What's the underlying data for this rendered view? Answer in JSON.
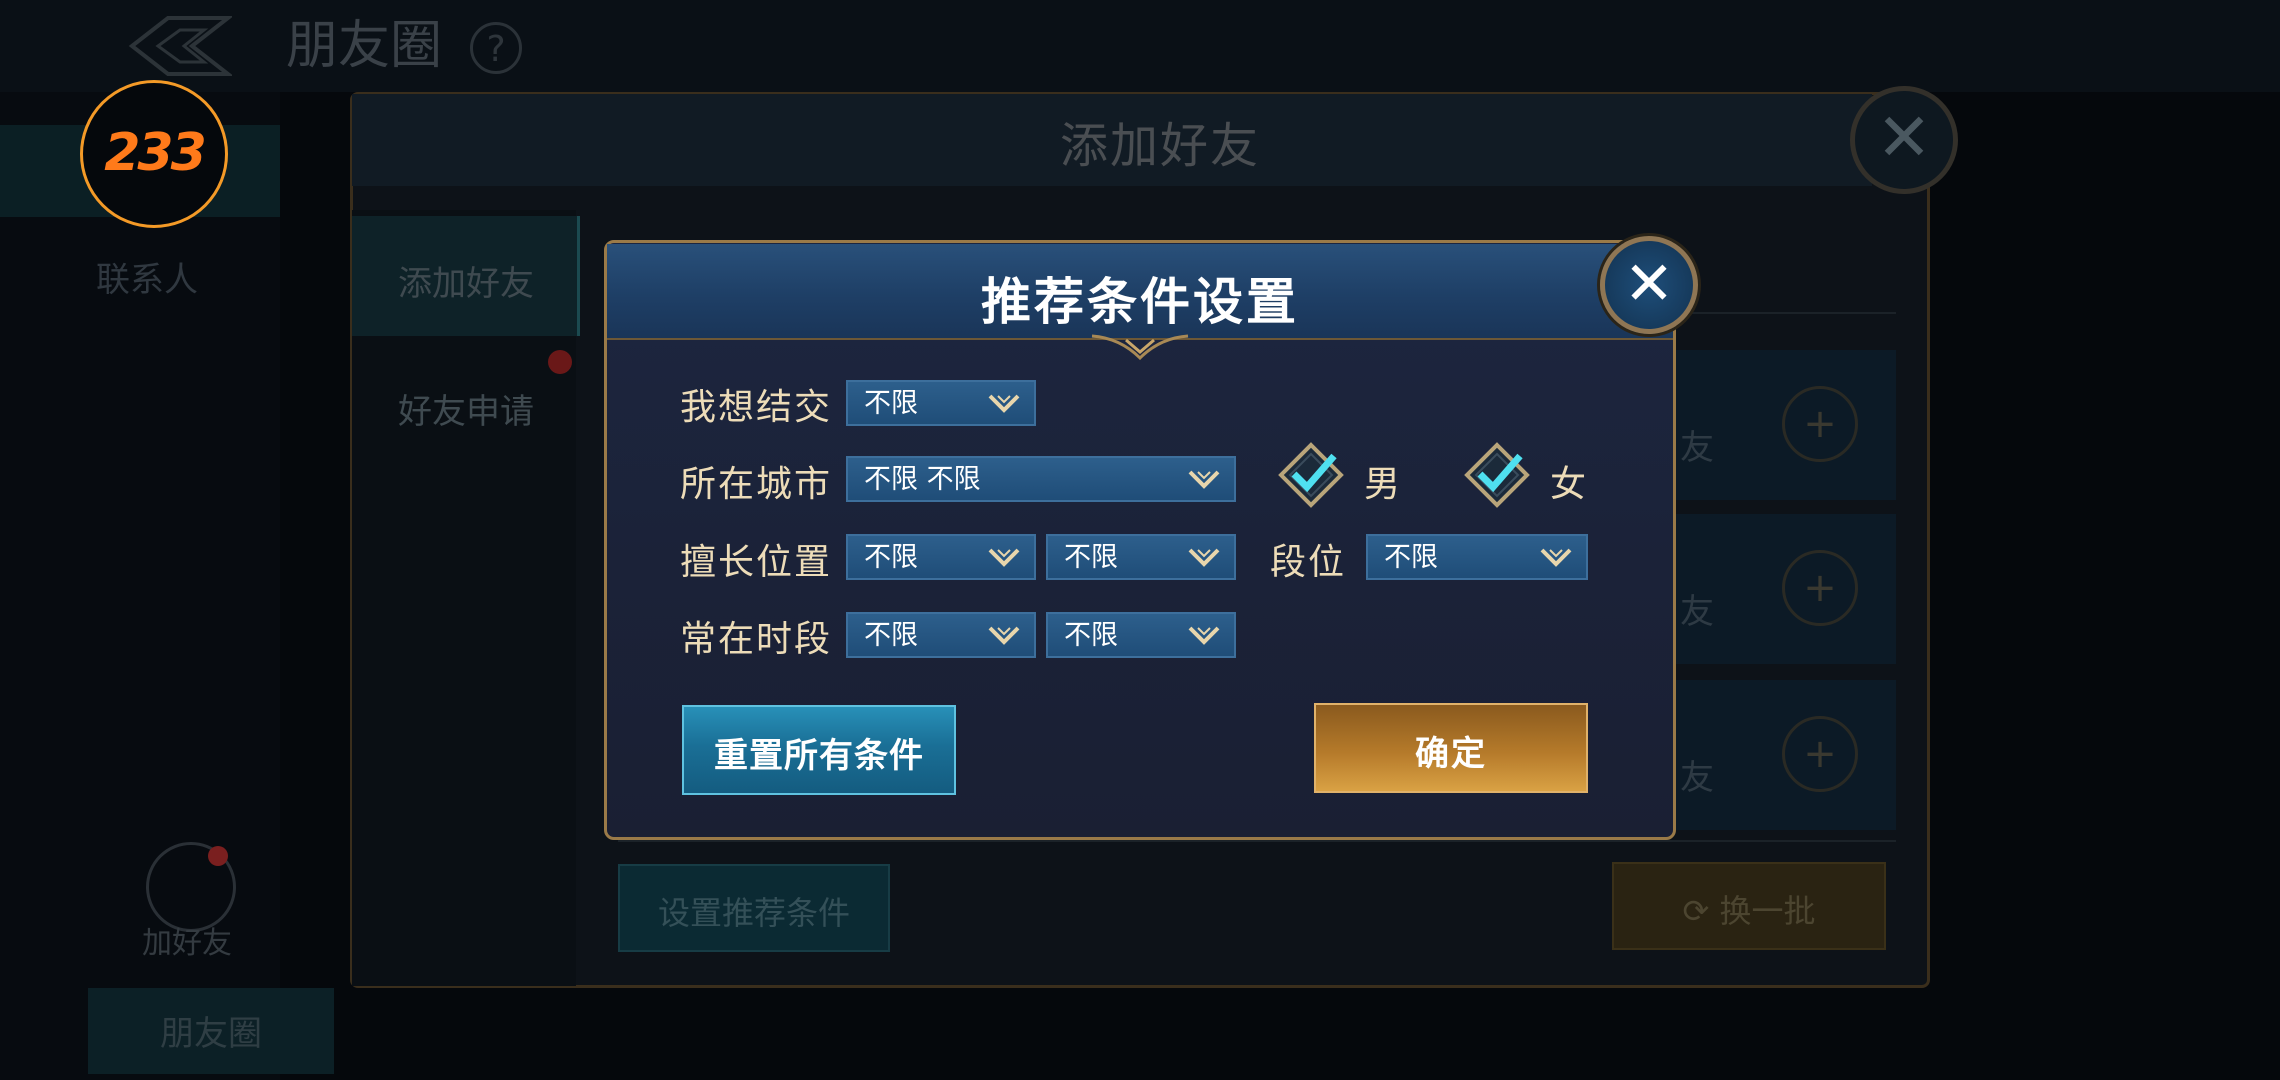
{
  "background": {
    "page_title": "朋友圈",
    "help_glyph": "?",
    "contacts_label": "联系人",
    "add_friend_label": "加好友",
    "moments_tab_label": "朋友圈",
    "avatar_badge_text": "233"
  },
  "panel": {
    "title": "添加好友",
    "tabs": [
      {
        "label": "添加好友"
      },
      {
        "label": "好友申请"
      }
    ],
    "recommendation_row_text": "友",
    "set_conditions_button": "设置推荐条件",
    "refresh_button": "换一批"
  },
  "dialog": {
    "title": "推荐条件设置",
    "fields": {
      "want_to_meet": {
        "label": "我想结交",
        "value": "不限"
      },
      "city": {
        "label": "所在城市",
        "value": "不限 不限"
      },
      "position": {
        "label": "擅长位置",
        "value1": "不限",
        "value2": "不限"
      },
      "rank": {
        "label": "段位",
        "value": "不限"
      },
      "time": {
        "label": "常在时段",
        "value1": "不限",
        "value2": "不限"
      }
    },
    "gender": [
      {
        "label": "男",
        "checked": true
      },
      {
        "label": "女",
        "checked": true
      }
    ],
    "reset_button": "重置所有条件",
    "confirm_button": "确定"
  },
  "colors": {
    "accent_gold": "#9a7a48",
    "select_blue": "#1f4d78",
    "check_cyan": "#4fe0f0",
    "reset_blue": "#1a6f96",
    "confirm_gold": "#b57a2a",
    "avatar_orange": "#ff7a1a"
  }
}
